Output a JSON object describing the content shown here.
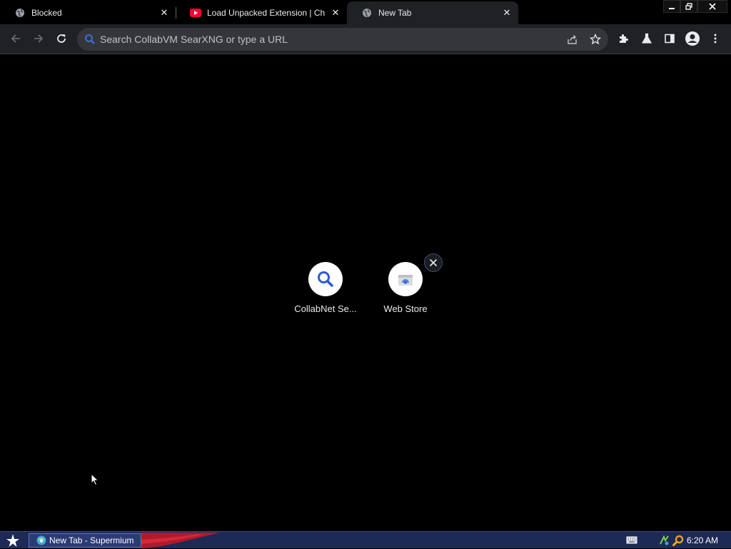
{
  "browser": {
    "tabs": [
      {
        "title": "Blocked",
        "favicon": "globe-icon",
        "active": false
      },
      {
        "title": "Load Unpacked Extension | Chrome Extensions",
        "favicon": "youtube-icon",
        "active": false
      },
      {
        "title": "New Tab",
        "favicon": "globe-icon",
        "active": true
      }
    ],
    "window_controls": [
      "minimize",
      "restore",
      "close"
    ]
  },
  "toolbar": {
    "omnibox_placeholder": "Search CollabVM SearXNG or type a URL",
    "buttons": [
      "back",
      "forward",
      "reload",
      "share",
      "bookmark",
      "extensions",
      "labs",
      "side-panel",
      "profile",
      "menu"
    ]
  },
  "new_tab": {
    "shortcuts": [
      {
        "label": "CollabNet Se...",
        "icon": "search-icon"
      },
      {
        "label": "Web Store",
        "icon": "webstore-icon"
      }
    ]
  },
  "taskbar": {
    "task_label": "New Tab - Supermium",
    "clock": "6:20 AM"
  },
  "colors": {
    "background": "#000000",
    "toolbar": "#202124",
    "omnibox": "#35363a",
    "taskbar": "#1d2a55",
    "search_accent": "#3c6fd8"
  }
}
